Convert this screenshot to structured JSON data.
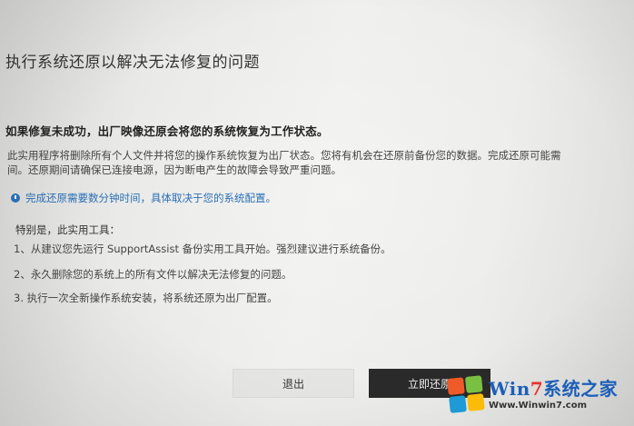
{
  "dialog": {
    "title": "执行系统还原以解决无法修复的问题",
    "heading": "如果修复未成功，出厂映像还原会将您的系统恢复为工作状态。",
    "description": [
      "此实用程序将删除所有个人文件并将您的操作系统恢复为出厂状态。您将有机会在还原前备份您的数据。完成还原可能需",
      "间。还原期间请确保已连接电源，因为断电产生的故障会导致严重问题。"
    ],
    "info": "完成还原需要数分钟时间，具体取决于您的系统配置。",
    "special_label": "特别是，此实用工具：",
    "items": [
      "1、从建议您先运行 SupportAssist 备份实用工具开始。强烈建议进行系统备份。",
      "2、永久删除您的系统上的所有文件以解决无法修复的问题。",
      "3. 执行一次全新操作系统安装，将系统还原为出厂配置。"
    ],
    "buttons": {
      "exit": "退出",
      "restore": "立即还原"
    }
  },
  "watermark": {
    "brand_w": "W",
    "brand_in": "in",
    "brand_7": "7",
    "brand_cn": "系统之家",
    "url": "Www.Winwin7.com"
  },
  "colors": {
    "info_accent": "#2a6fb5",
    "restore_button": "#2a2a2a"
  }
}
